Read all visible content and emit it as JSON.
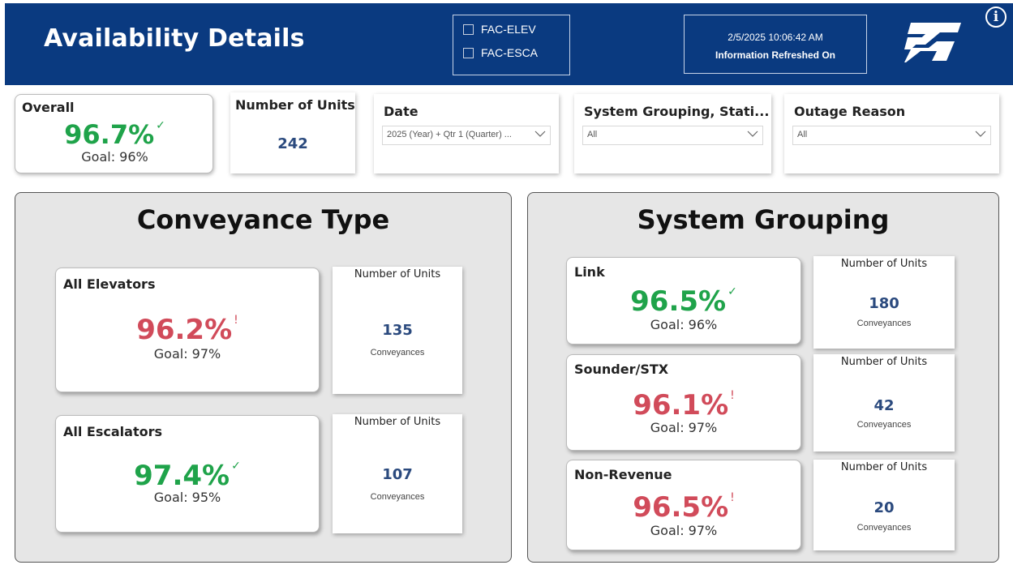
{
  "header": {
    "title": "Availability Details",
    "filters": [
      {
        "label": "FAC-ELEV",
        "checked": false
      },
      {
        "label": "FAC-ESCA",
        "checked": false
      }
    ],
    "refresh_timestamp": "2/5/2025 10:06:42 AM",
    "refresh_label": "Information Refreshed On",
    "info_icon": "i",
    "colors": {
      "header_bg": "#0a3a80"
    }
  },
  "overall": {
    "label": "Overall",
    "value": "96.7%",
    "goal": "Goal: 96%",
    "status": "met"
  },
  "units_total": {
    "label": "Number of Units",
    "value": "242"
  },
  "slicers": {
    "date": {
      "label": "Date",
      "value": "2025 (Year) + Qtr 1 (Quarter) ..."
    },
    "system": {
      "label": "System Grouping, Stati...",
      "value": "All"
    },
    "outage": {
      "label": "Outage Reason",
      "value": "All"
    }
  },
  "conveyance": {
    "title": "Conveyance Type",
    "items": [
      {
        "name": "All Elevators",
        "value": "96.2%",
        "goal": "Goal: 97%",
        "status": "missed",
        "units_label": "Number of Units",
        "units": "135",
        "units_sub": "Conveyances"
      },
      {
        "name": "All Escalators",
        "value": "97.4%",
        "goal": "Goal: 95%",
        "status": "met",
        "units_label": "Number of Units",
        "units": "107",
        "units_sub": "Conveyances"
      }
    ]
  },
  "system_grouping": {
    "title": "System Grouping",
    "items": [
      {
        "name": "Link",
        "value": "96.5%",
        "goal": "Goal: 96%",
        "status": "met",
        "units_label": "Number of Units",
        "units": "180",
        "units_sub": "Conveyances"
      },
      {
        "name": "Sounder/STX",
        "value": "96.1%",
        "goal": "Goal: 97%",
        "status": "missed",
        "units_label": "Number of Units",
        "units": "42",
        "units_sub": "Conveyances"
      },
      {
        "name": "Non-Revenue",
        "value": "96.5%",
        "goal": "Goal: 97%",
        "status": "missed",
        "units_label": "Number of Units",
        "units": "20",
        "units_sub": "Conveyances"
      }
    ]
  },
  "colors": {
    "met": "#1fa34a",
    "missed": "#d14b5a",
    "units_number": "#2b4a7e"
  },
  "icons": {
    "met": "checkmark-icon",
    "missed": "alert-icon",
    "dropdown": "chevron-down-icon"
  }
}
